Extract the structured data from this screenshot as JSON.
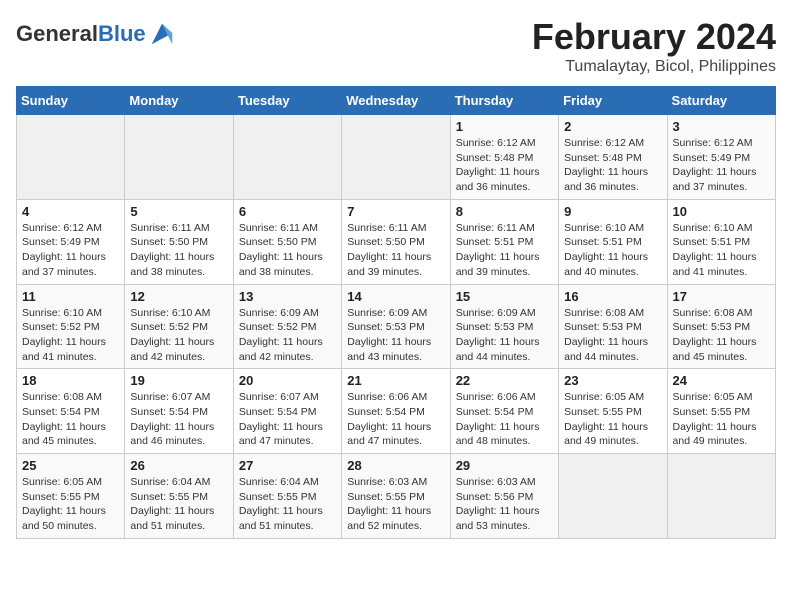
{
  "logo": {
    "general": "General",
    "blue": "Blue"
  },
  "title": "February 2024",
  "subtitle": "Tumalaytay, Bicol, Philippines",
  "weekdays": [
    "Sunday",
    "Monday",
    "Tuesday",
    "Wednesday",
    "Thursday",
    "Friday",
    "Saturday"
  ],
  "weeks": [
    [
      {
        "day": "",
        "info": ""
      },
      {
        "day": "",
        "info": ""
      },
      {
        "day": "",
        "info": ""
      },
      {
        "day": "",
        "info": ""
      },
      {
        "day": "1",
        "sunrise": "6:12 AM",
        "sunset": "5:48 PM",
        "daylight": "11 hours and 36 minutes."
      },
      {
        "day": "2",
        "sunrise": "6:12 AM",
        "sunset": "5:48 PM",
        "daylight": "11 hours and 36 minutes."
      },
      {
        "day": "3",
        "sunrise": "6:12 AM",
        "sunset": "5:49 PM",
        "daylight": "11 hours and 37 minutes."
      }
    ],
    [
      {
        "day": "4",
        "sunrise": "6:12 AM",
        "sunset": "5:49 PM",
        "daylight": "11 hours and 37 minutes."
      },
      {
        "day": "5",
        "sunrise": "6:11 AM",
        "sunset": "5:50 PM",
        "daylight": "11 hours and 38 minutes."
      },
      {
        "day": "6",
        "sunrise": "6:11 AM",
        "sunset": "5:50 PM",
        "daylight": "11 hours and 38 minutes."
      },
      {
        "day": "7",
        "sunrise": "6:11 AM",
        "sunset": "5:50 PM",
        "daylight": "11 hours and 39 minutes."
      },
      {
        "day": "8",
        "sunrise": "6:11 AM",
        "sunset": "5:51 PM",
        "daylight": "11 hours and 39 minutes."
      },
      {
        "day": "9",
        "sunrise": "6:10 AM",
        "sunset": "5:51 PM",
        "daylight": "11 hours and 40 minutes."
      },
      {
        "day": "10",
        "sunrise": "6:10 AM",
        "sunset": "5:51 PM",
        "daylight": "11 hours and 41 minutes."
      }
    ],
    [
      {
        "day": "11",
        "sunrise": "6:10 AM",
        "sunset": "5:52 PM",
        "daylight": "11 hours and 41 minutes."
      },
      {
        "day": "12",
        "sunrise": "6:10 AM",
        "sunset": "5:52 PM",
        "daylight": "11 hours and 42 minutes."
      },
      {
        "day": "13",
        "sunrise": "6:09 AM",
        "sunset": "5:52 PM",
        "daylight": "11 hours and 42 minutes."
      },
      {
        "day": "14",
        "sunrise": "6:09 AM",
        "sunset": "5:53 PM",
        "daylight": "11 hours and 43 minutes."
      },
      {
        "day": "15",
        "sunrise": "6:09 AM",
        "sunset": "5:53 PM",
        "daylight": "11 hours and 44 minutes."
      },
      {
        "day": "16",
        "sunrise": "6:08 AM",
        "sunset": "5:53 PM",
        "daylight": "11 hours and 44 minutes."
      },
      {
        "day": "17",
        "sunrise": "6:08 AM",
        "sunset": "5:53 PM",
        "daylight": "11 hours and 45 minutes."
      }
    ],
    [
      {
        "day": "18",
        "sunrise": "6:08 AM",
        "sunset": "5:54 PM",
        "daylight": "11 hours and 45 minutes."
      },
      {
        "day": "19",
        "sunrise": "6:07 AM",
        "sunset": "5:54 PM",
        "daylight": "11 hours and 46 minutes."
      },
      {
        "day": "20",
        "sunrise": "6:07 AM",
        "sunset": "5:54 PM",
        "daylight": "11 hours and 47 minutes."
      },
      {
        "day": "21",
        "sunrise": "6:06 AM",
        "sunset": "5:54 PM",
        "daylight": "11 hours and 47 minutes."
      },
      {
        "day": "22",
        "sunrise": "6:06 AM",
        "sunset": "5:54 PM",
        "daylight": "11 hours and 48 minutes."
      },
      {
        "day": "23",
        "sunrise": "6:05 AM",
        "sunset": "5:55 PM",
        "daylight": "11 hours and 49 minutes."
      },
      {
        "day": "24",
        "sunrise": "6:05 AM",
        "sunset": "5:55 PM",
        "daylight": "11 hours and 49 minutes."
      }
    ],
    [
      {
        "day": "25",
        "sunrise": "6:05 AM",
        "sunset": "5:55 PM",
        "daylight": "11 hours and 50 minutes."
      },
      {
        "day": "26",
        "sunrise": "6:04 AM",
        "sunset": "5:55 PM",
        "daylight": "11 hours and 51 minutes."
      },
      {
        "day": "27",
        "sunrise": "6:04 AM",
        "sunset": "5:55 PM",
        "daylight": "11 hours and 51 minutes."
      },
      {
        "day": "28",
        "sunrise": "6:03 AM",
        "sunset": "5:55 PM",
        "daylight": "11 hours and 52 minutes."
      },
      {
        "day": "29",
        "sunrise": "6:03 AM",
        "sunset": "5:56 PM",
        "daylight": "11 hours and 53 minutes."
      },
      {
        "day": "",
        "info": ""
      },
      {
        "day": "",
        "info": ""
      }
    ]
  ]
}
